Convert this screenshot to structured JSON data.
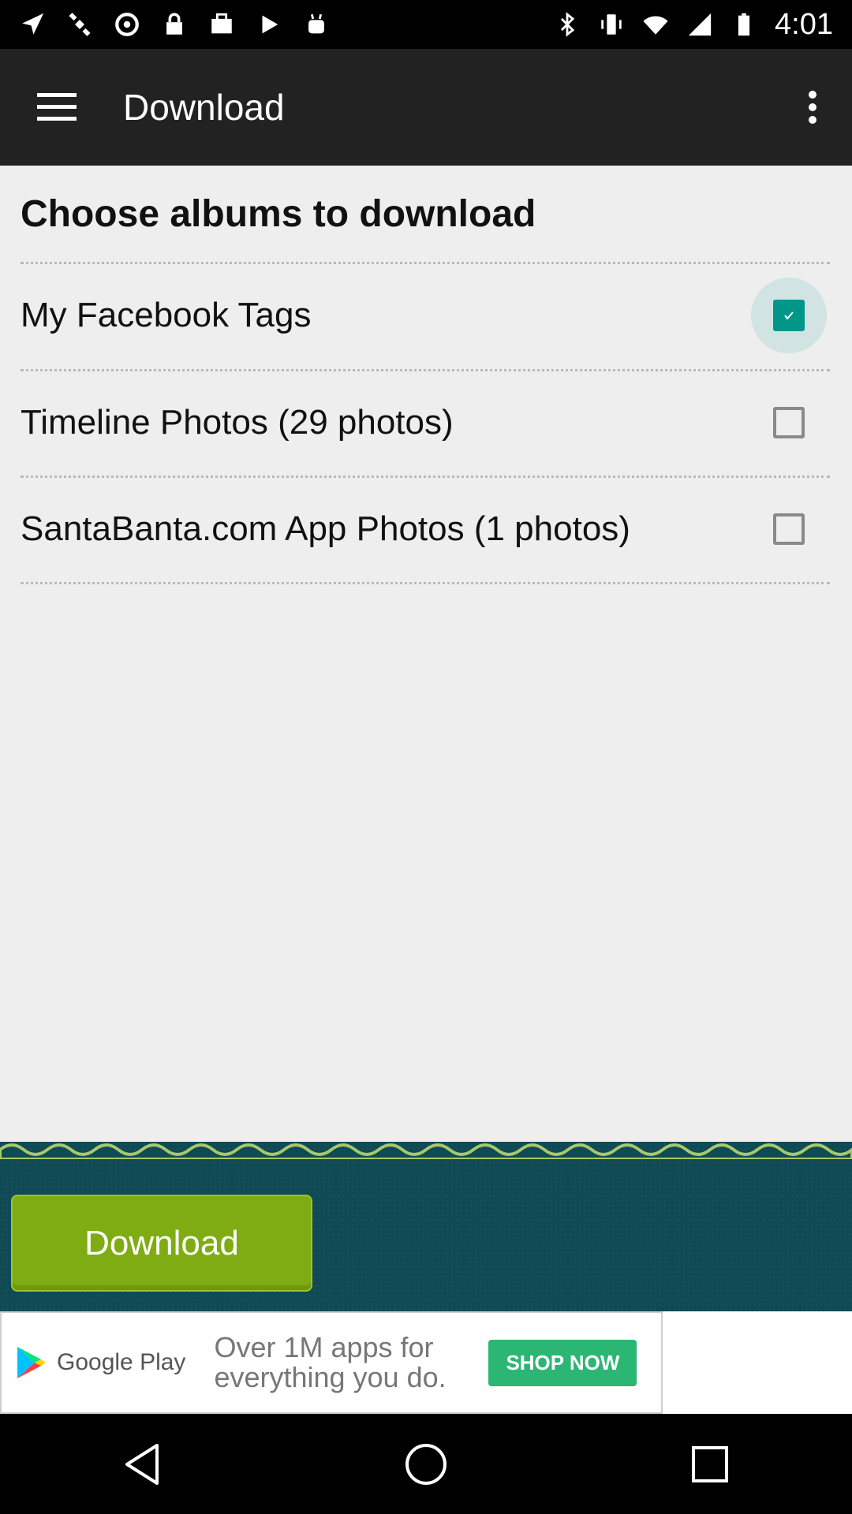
{
  "status_bar": {
    "time": "4:01",
    "icons_left": [
      "fake-gps-icon",
      "satellite-icon",
      "data-saver-icon",
      "lock-icon",
      "briefcase-icon",
      "play-icon",
      "android-icon"
    ],
    "icons_right": [
      "bluetooth-icon",
      "vibrate-icon",
      "wifi-icon",
      "signal-icon",
      "battery-icon"
    ]
  },
  "app_bar": {
    "title": "Download",
    "menu_icon": "hamburger-menu-icon",
    "overflow_icon": "more-vert-icon"
  },
  "content": {
    "heading": "Choose albums to download",
    "albums": [
      {
        "label": "My Facebook Tags",
        "checked": true
      },
      {
        "label": "Timeline Photos (29 photos)",
        "checked": false
      },
      {
        "label": "SantaBanta.com App Photos (1 photos)",
        "checked": false
      }
    ]
  },
  "download_button": {
    "label": "Download"
  },
  "ad": {
    "brand": "Google Play",
    "text": "Over 1M apps for everything you do.",
    "cta": "SHOP NOW"
  },
  "nav_bar": {
    "icons": [
      "back-icon",
      "home-icon",
      "recents-icon"
    ]
  },
  "colors": {
    "app_bar": "#222222",
    "accent": "#009688",
    "download_button": "#7fac12",
    "bottom_panel": "#0f4a55"
  }
}
